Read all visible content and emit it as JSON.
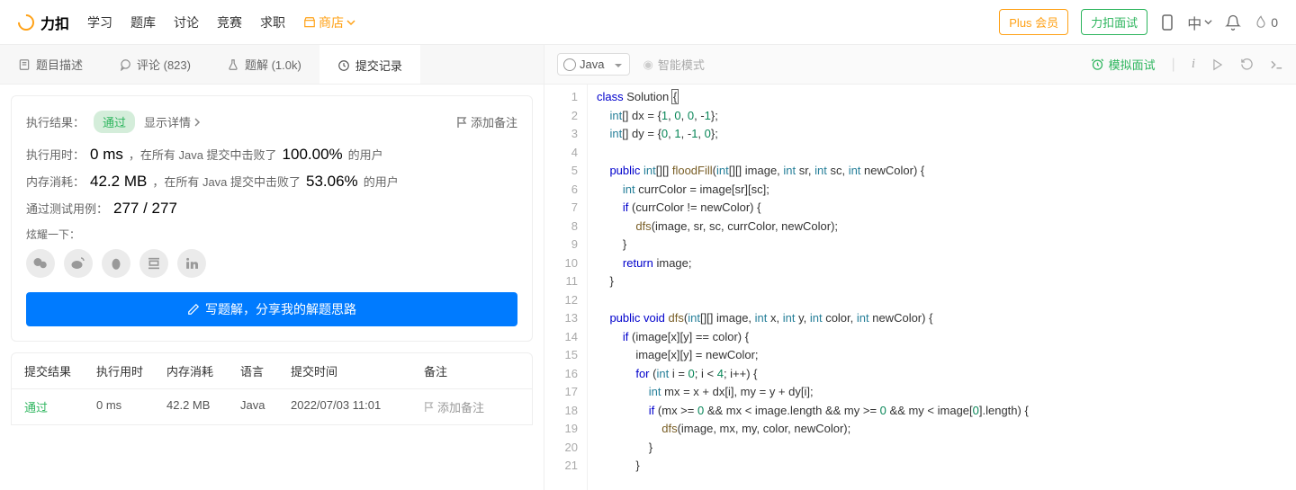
{
  "header": {
    "logo_text": "力扣",
    "nav": [
      "学习",
      "题库",
      "讨论",
      "竞赛",
      "求职"
    ],
    "store": "商店",
    "plus": "Plus 会员",
    "interview": "力扣面试",
    "lang_switch": "中",
    "fire_count": "0"
  },
  "leftTabs": {
    "desc": "题目描述",
    "comments": "评论 (823)",
    "solutions": "题解 (1.0k)",
    "submissions": "提交记录"
  },
  "result": {
    "exec_label": "执行结果：",
    "status": "通过",
    "show_detail": "显示详情",
    "add_note": "添加备注",
    "runtime_label": "执行用时：",
    "runtime_value": "0 ms",
    "runtime_mid": "，在所有 Java 提交中击败了",
    "runtime_pct": "100.00%",
    "runtime_suffix": " 的用户",
    "memory_label": "内存消耗：",
    "memory_value": "42.2 MB",
    "memory_mid": "，在所有 Java 提交中击败了",
    "memory_pct": "53.06%",
    "memory_suffix": " 的用户",
    "testcase_label": "通过测试用例：",
    "testcase_value": "277 / 277",
    "share_label": "炫耀一下：",
    "write_btn": "写题解，分享我的解题思路"
  },
  "table": {
    "headers": {
      "result": "提交结果",
      "time": "执行用时",
      "memory": "内存消耗",
      "lang": "语言",
      "date": "提交时间",
      "note": "备注"
    },
    "row": {
      "result": "通过",
      "time": "0 ms",
      "memory": "42.2 MB",
      "lang": "Java",
      "date": "2022/07/03 11:01",
      "note": "添加备注"
    }
  },
  "editor": {
    "language": "Java",
    "smart_mode": "智能模式",
    "mock": "模拟面试",
    "lines": [
      "class Solution {",
      "    int[] dx = {1, 0, 0, -1};",
      "    int[] dy = {0, 1, -1, 0};",
      "",
      "    public int[][] floodFill(int[][] image, int sr, int sc, int newColor) {",
      "        int currColor = image[sr][sc];",
      "        if (currColor != newColor) {",
      "            dfs(image, sr, sc, currColor, newColor);",
      "        }",
      "        return image;",
      "    }",
      "",
      "    public void dfs(int[][] image, int x, int y, int color, int newColor) {",
      "        if (image[x][y] == color) {",
      "            image[x][y] = newColor;",
      "            for (int i = 0; i < 4; i++) {",
      "                int mx = x + dx[i], my = y + dy[i];",
      "                if (mx >= 0 && mx < image.length && my >= 0 && my < image[0].length) {",
      "                    dfs(image, mx, my, color, newColor);",
      "                }",
      "            }"
    ],
    "line_count": 21
  }
}
